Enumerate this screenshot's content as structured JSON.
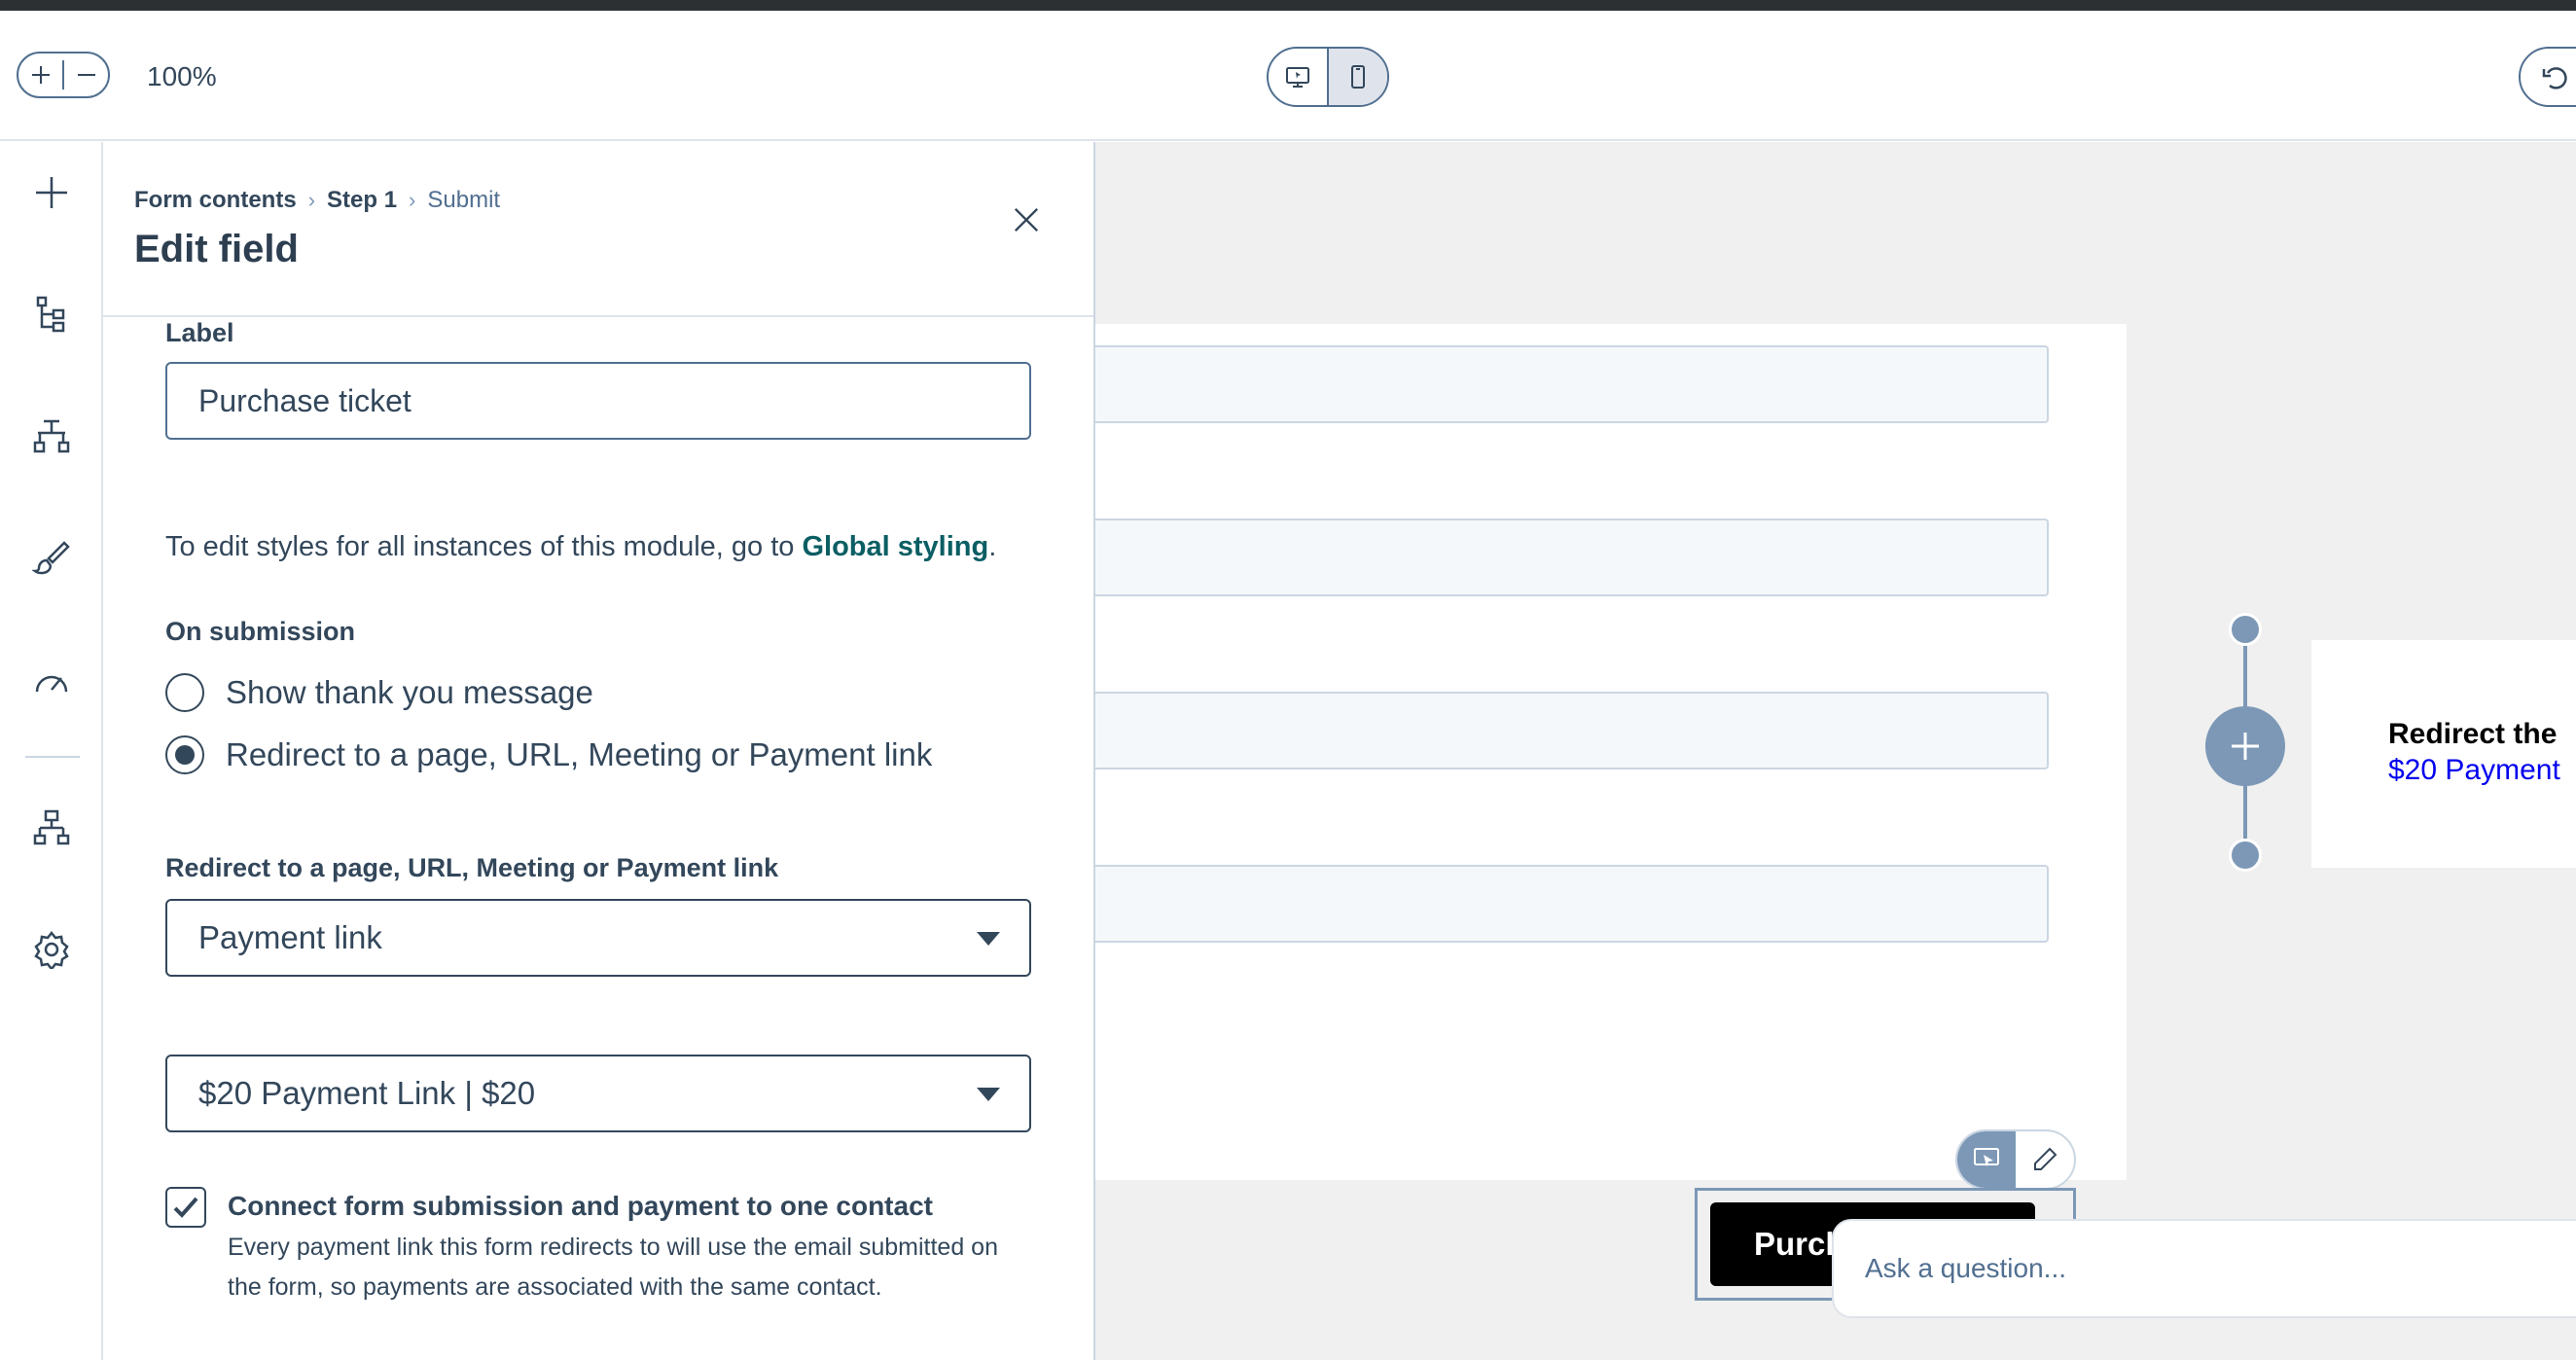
{
  "toolbar": {
    "zoom_level": "100%"
  },
  "panel": {
    "breadcrumb": [
      "Form contents",
      "Step 1",
      "Submit"
    ],
    "title": "Edit field",
    "label_heading": "Label",
    "label_value": "Purchase ticket",
    "styles_note_prefix": "To edit styles for all instances of this module, go to ",
    "styles_note_link": "Global styling",
    "styles_note_suffix": ".",
    "on_submission_heading": "On submission",
    "radio_options": [
      {
        "label": "Show thank you message",
        "selected": false
      },
      {
        "label": "Redirect to a page, URL, Meeting or Payment link",
        "selected": true
      }
    ],
    "redirect_heading": "Redirect to a page, URL, Meeting or Payment link",
    "redirect_type": "Payment link",
    "payment_link": "$20 Payment Link | $20",
    "connect_checkbox": {
      "checked": true,
      "title": "Connect form submission and payment to one contact",
      "description": "Every payment link this form redirects to will use the email submitted on the form, so payments are associated with the same contact."
    }
  },
  "canvas": {
    "submit_button_label": "Purchase ticket",
    "flow_card_title": "Redirect the",
    "flow_card_link": "$20 Payment",
    "ask_placeholder": "Ask a question..."
  },
  "icons": {
    "rail": [
      "plus-icon",
      "tree-icon",
      "hierarchy-icon",
      "brush-icon",
      "gauge-icon",
      "flow-icon",
      "gear-icon"
    ]
  }
}
